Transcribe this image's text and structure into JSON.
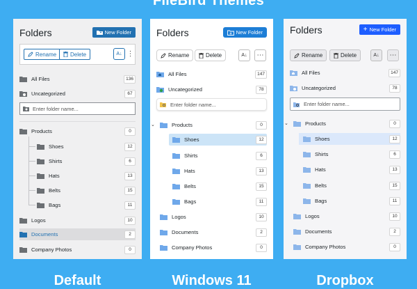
{
  "title": "FileBird Themes",
  "colors": {
    "default_accent": "#2271b1",
    "win_accent": "#1d7ed6",
    "drop_accent": "#1e5eff",
    "folder_gray": "#6b6f73",
    "folder_blue": "#6fa8ea"
  },
  "panels": [
    {
      "id": "default",
      "caption": "Default",
      "heading": "Folders",
      "new_folder": "New Folder",
      "rename": "Rename",
      "delete": "Delete",
      "all_files": {
        "label": "All Files",
        "count": "136"
      },
      "uncategorized": {
        "label": "Uncategorized",
        "count": "67"
      },
      "placeholder": "Enter folder name...",
      "folders": [
        {
          "label": "Products",
          "count": "0"
        },
        {
          "label": "Shoes",
          "count": "12"
        },
        {
          "label": "Shirts",
          "count": "6"
        },
        {
          "label": "Hats",
          "count": "13"
        },
        {
          "label": "Belts",
          "count": "15"
        },
        {
          "label": "Bags",
          "count": "11"
        },
        {
          "label": "Logos",
          "count": "10"
        },
        {
          "label": "Documents",
          "count": "2"
        },
        {
          "label": "Company Photos",
          "count": "0"
        }
      ]
    },
    {
      "id": "windows",
      "caption": "Windows 11",
      "heading": "Folders",
      "new_folder": "New Folder",
      "rename": "Rename",
      "delete": "Delete",
      "all_files": {
        "label": "All Files",
        "count": "147"
      },
      "uncategorized": {
        "label": "Uncategorized",
        "count": "78"
      },
      "placeholder": "Enter folder name...",
      "folders": [
        {
          "label": "Products",
          "count": "0"
        },
        {
          "label": "Shoes",
          "count": "12"
        },
        {
          "label": "Shirts",
          "count": "6"
        },
        {
          "label": "Hats",
          "count": "13"
        },
        {
          "label": "Belts",
          "count": "15"
        },
        {
          "label": "Bags",
          "count": "11"
        },
        {
          "label": "Logos",
          "count": "10"
        },
        {
          "label": "Documents",
          "count": "2"
        },
        {
          "label": "Company Photos",
          "count": "0"
        }
      ]
    },
    {
      "id": "dropbox",
      "caption": "Dropbox",
      "heading": "Folders",
      "new_folder": "New Folder",
      "rename": "Rename",
      "delete": "Delete",
      "all_files": {
        "label": "All Files",
        "count": "147"
      },
      "uncategorized": {
        "label": "Uncategorized",
        "count": "78"
      },
      "placeholder": "Enter folder name...",
      "folders": [
        {
          "label": "Products",
          "count": "0"
        },
        {
          "label": "Shoes",
          "count": "12"
        },
        {
          "label": "Shirts",
          "count": "6"
        },
        {
          "label": "Hats",
          "count": "13"
        },
        {
          "label": "Belts",
          "count": "15"
        },
        {
          "label": "Bags",
          "count": "11"
        },
        {
          "label": "Logos",
          "count": "10"
        },
        {
          "label": "Documents",
          "count": "2"
        },
        {
          "label": "Company Photos",
          "count": "0"
        }
      ]
    }
  ]
}
